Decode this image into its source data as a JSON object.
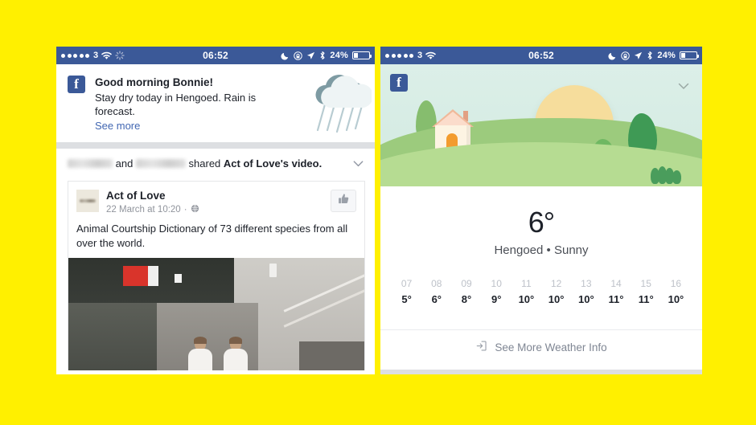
{
  "theme": {
    "background": "#FFF000",
    "facebook_blue": "#3b5998",
    "link_blue": "#4267b2"
  },
  "status_bar": {
    "carrier": "3",
    "time": "06:52",
    "battery_percent": "24%",
    "icons_left": [
      "signal-dots",
      "carrier-label",
      "wifi-icon",
      "activity-spinner-icon"
    ],
    "icons_right": [
      "do-not-disturb-moon-icon",
      "rotation-lock-icon",
      "location-arrow-icon",
      "bluetooth-icon",
      "battery-icon"
    ]
  },
  "left_panel": {
    "notification": {
      "app_badge": "f",
      "title": "Good morning Bonnie!",
      "body": "Stay dry today in Hengoed. Rain is forecast.",
      "link": "See more",
      "weather_icon": "rain-cloud-icon"
    },
    "story": {
      "sharer_one": "",
      "connector": " and ",
      "sharer_two": "",
      "action": " shared ",
      "object": "Act of Love's video.",
      "menu_icon": "chevron-down-icon",
      "attachment": {
        "avatar": "act-of-love-logo",
        "page_name": "Act of Love",
        "timestamp": "22 March at 10:20",
        "privacy_icon": "globe-icon",
        "meta_separator": "·",
        "like_icon": "thumbs-up-icon",
        "description": "Animal Courtship Dictionary of 73 different species from all over the world.",
        "photo_alt": "video-thumbnail"
      }
    }
  },
  "right_panel": {
    "hero": {
      "app_badge": "f",
      "menu_icon": "chevron-down-icon",
      "illustration": "papercraft-landscape-house-sun-trees"
    },
    "current": {
      "temperature": "6°",
      "location": "Hengoed",
      "separator": "•",
      "condition": "Sunny"
    },
    "hourly": [
      {
        "hour": "07",
        "temp": "5°"
      },
      {
        "hour": "08",
        "temp": "6°"
      },
      {
        "hour": "09",
        "temp": "8°"
      },
      {
        "hour": "10",
        "temp": "9°"
      },
      {
        "hour": "11",
        "temp": "10°"
      },
      {
        "hour": "12",
        "temp": "10°"
      },
      {
        "hour": "13",
        "temp": "10°"
      },
      {
        "hour": "14",
        "temp": "11°"
      },
      {
        "hour": "15",
        "temp": "11°"
      },
      {
        "hour": "16",
        "temp": "10°"
      }
    ],
    "more_link": {
      "icon": "open-external-icon",
      "label": "See More Weather Info"
    }
  }
}
